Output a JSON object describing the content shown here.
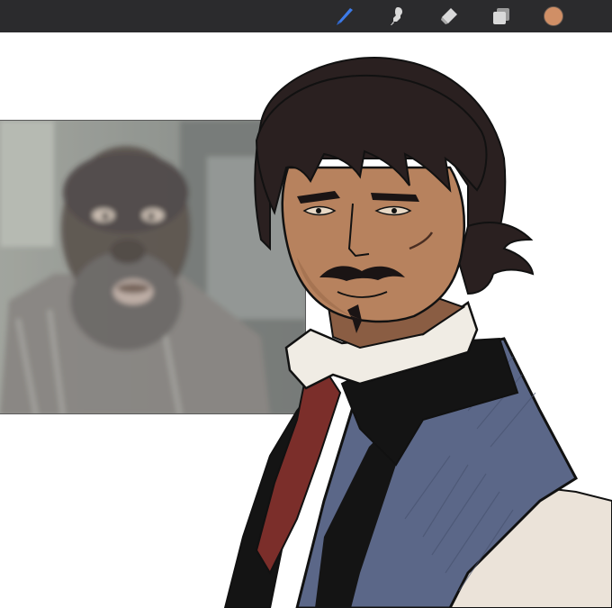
{
  "toolbar": {
    "tools": [
      {
        "name": "brush-icon",
        "active": true
      },
      {
        "name": "smudge-icon",
        "active": false
      },
      {
        "name": "eraser-icon",
        "active": false
      },
      {
        "name": "layers-icon",
        "active": false
      }
    ],
    "current_color": "#d08f66"
  },
  "colors": {
    "toolbar_bg": "#2b2b2d",
    "active_tool": "#3d7be8",
    "inactive_tool": "#d9d9d9",
    "skin": "#b7825e",
    "hair": "#2a2020",
    "vest": "#5b6788",
    "shirt": "#f0ece4",
    "tie": "#7b2e2a",
    "coat_black": "#141414"
  }
}
